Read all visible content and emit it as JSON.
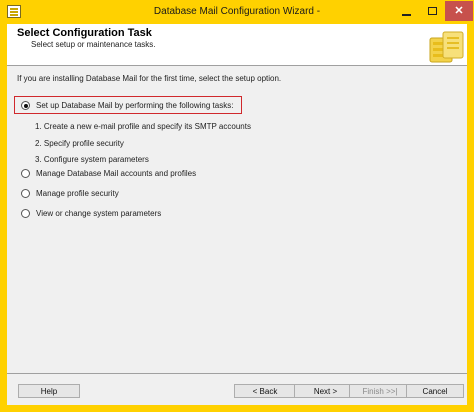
{
  "window": {
    "title": "Database Mail Configuration Wizard -"
  },
  "header": {
    "title": "Select Configuration Task",
    "subtitle": "Select setup or maintenance tasks."
  },
  "main": {
    "intro": "If you are installing Database Mail for the first time, select the setup option.",
    "options": [
      {
        "label": "Set up Database Mail by performing the following tasks:",
        "checked": true
      },
      {
        "label": "Manage Database Mail accounts and profiles",
        "checked": false
      },
      {
        "label": "Manage profile security",
        "checked": false
      },
      {
        "label": "View or change system parameters",
        "checked": false
      }
    ],
    "tasks": [
      "1. Create a new e-mail profile and specify its SMTP accounts",
      "2. Specify profile security",
      "3. Configure system parameters"
    ]
  },
  "footer": {
    "help": "Help",
    "back": "< Back",
    "next": "Next >",
    "finish": "Finish >>|",
    "cancel": "Cancel"
  },
  "colors": {
    "titlebar": "#ffd100",
    "close_button": "#c7514c",
    "highlight_border": "#d0282c"
  },
  "icons": {
    "app": "wizard-app-icon",
    "header_art": "database-mail-icon"
  }
}
